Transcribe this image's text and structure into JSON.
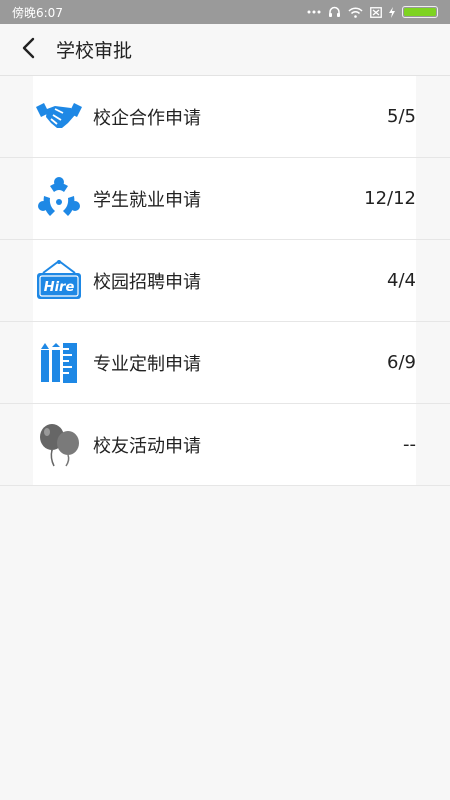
{
  "status_bar": {
    "time": "傍晚6:07"
  },
  "header": {
    "title": "学校审批"
  },
  "items": [
    {
      "label": "校企合作申请",
      "value": "5/5",
      "icon": "handshake-icon"
    },
    {
      "label": "学生就业申请",
      "value": "12/12",
      "icon": "people-network-icon"
    },
    {
      "label": "校园招聘申请",
      "value": "4/4",
      "icon": "hire-sign-icon"
    },
    {
      "label": "专业定制申请",
      "value": "6/9",
      "icon": "ruler-pencil-icon"
    },
    {
      "label": "校友活动申请",
      "value": "--",
      "icon": "balloons-icon"
    }
  ],
  "colors": {
    "accent": "#1e88e5",
    "muted_icon": "#666666",
    "battery": "#7ed321"
  }
}
